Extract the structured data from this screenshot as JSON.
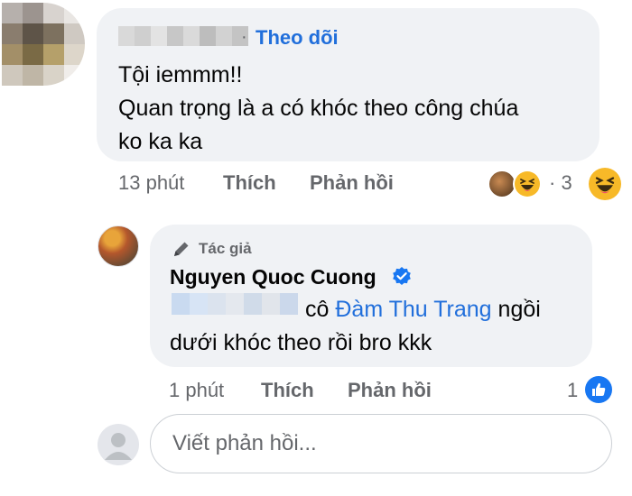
{
  "comment": {
    "follow_label": "Theo dõi",
    "separator": "·",
    "text_lines": [
      "Tội iemmm!!",
      "Quan trọng là a có khóc theo công chúa",
      "ko ka ka"
    ],
    "time": "13 phút",
    "like_label": "Thích",
    "reply_label": "Phản hồi",
    "reaction_count": "· 3",
    "reaction_icons": [
      "photo-reaction",
      "haha-icon",
      "haha-icon"
    ]
  },
  "reply": {
    "badge_label": "Tác giả",
    "author_name": "Nguyen Quoc Cuong",
    "verified_icon": "verified-check-icon",
    "text_prefix": "cô ",
    "tag_name": "Đàm Thu Trang",
    "text_suffix": " ngồi",
    "text_line2": "dưới khóc theo rồi bro kkk",
    "time": "1 phút",
    "like_label": "Thích",
    "reply_label": "Phản hồi",
    "reaction_count": "1",
    "reaction_icon": "like-icon"
  },
  "composer": {
    "placeholder": "Viết phản hồi..."
  },
  "colors": {
    "bubble": "#f0f2f5",
    "link_blue": "#216fdb",
    "secondary_text": "#65676b",
    "like_blue": "#1877f2",
    "haha_yellow": "#f7b928"
  }
}
